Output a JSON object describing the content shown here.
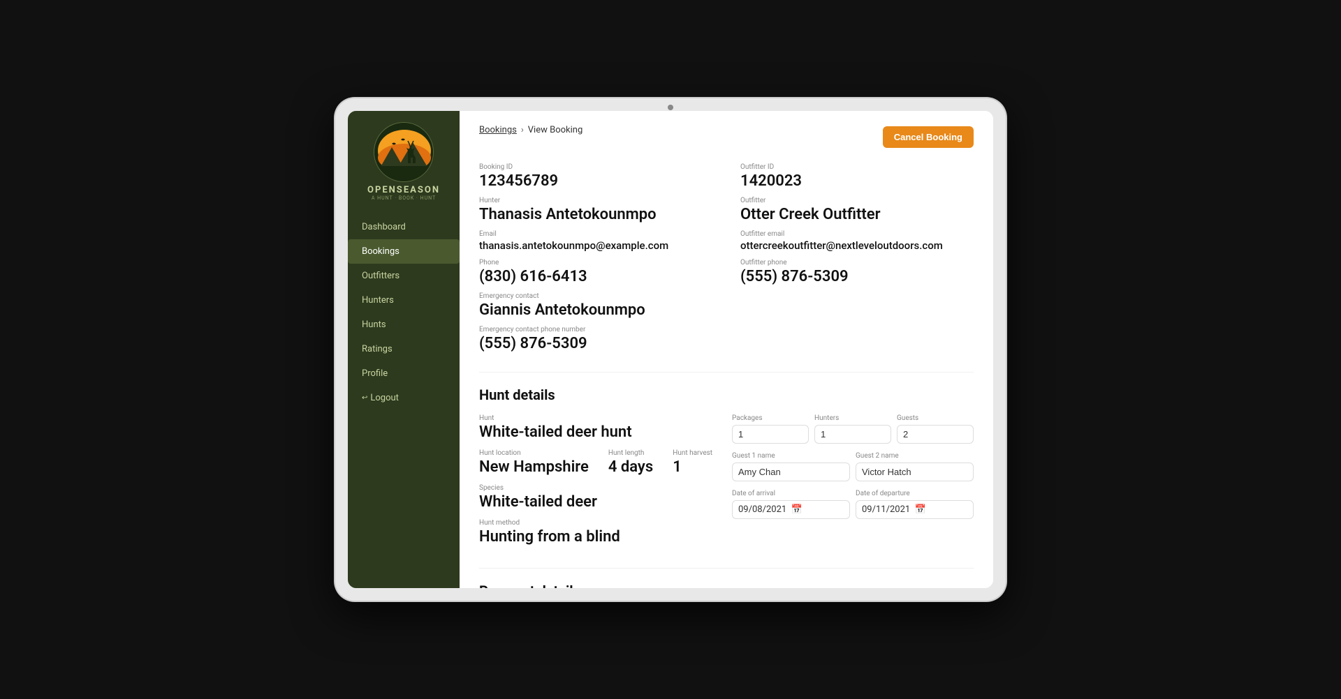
{
  "app": {
    "name": "OPENSEASON",
    "tagline": "A HUNT · BOOK · HUNT"
  },
  "sidebar": {
    "nav_items": [
      {
        "label": "Dashboard",
        "active": false,
        "id": "dashboard"
      },
      {
        "label": "Bookings",
        "active": true,
        "id": "bookings"
      },
      {
        "label": "Outfitters",
        "active": false,
        "id": "outfitters"
      },
      {
        "label": "Hunters",
        "active": false,
        "id": "hunters"
      },
      {
        "label": "Hunts",
        "active": false,
        "id": "hunts"
      },
      {
        "label": "Ratings",
        "active": false,
        "id": "ratings"
      },
      {
        "label": "Profile",
        "active": false,
        "id": "profile"
      },
      {
        "label": "Logout",
        "active": false,
        "id": "logout"
      }
    ]
  },
  "breadcrumb": {
    "parent": "Bookings",
    "separator": "›",
    "current": "View Booking"
  },
  "header": {
    "cancel_button": "Cancel Booking"
  },
  "booking": {
    "booking_id_label": "Booking ID",
    "booking_id": "123456789",
    "outfitter_id_label": "Outfitter ID",
    "outfitter_id": "1420023",
    "hunter_label": "Hunter",
    "hunter_name": "Thanasis Antetokounmpo",
    "outfitter_label": "Outfitter",
    "outfitter_name": "Otter Creek Outfitter",
    "email_label": "Email",
    "email": "thanasis.antetokounmpo@example.com",
    "outfitter_email_label": "Outfitter email",
    "outfitter_email": "ottercreekoutfitter@nextleveloutdoors.com",
    "phone_label": "Phone",
    "phone": "(830) 616-6413",
    "outfitter_phone_label": "Outfitter phone",
    "outfitter_phone": "(555) 876-5309",
    "emergency_contact_label": "Emergency contact",
    "emergency_contact": "Giannis Antetokounmpo",
    "emergency_phone_label": "Emergency contact phone number",
    "emergency_phone": "(555) 876-5309"
  },
  "hunt_details": {
    "section_title": "Hunt details",
    "hunt_label": "Hunt",
    "hunt_name": "White-tailed deer hunt",
    "hunt_location_label": "Hunt location",
    "hunt_location": "New Hampshire",
    "hunt_length_label": "Hunt length",
    "hunt_length": "4 days",
    "hunt_harvest_label": "Hunt harvest",
    "hunt_harvest": "1",
    "species_label": "Species",
    "species": "White-tailed deer",
    "hunt_method_label": "Hunt method",
    "hunt_method": "Hunting from a blind",
    "packages_label": "Packages",
    "packages_value": "1",
    "hunters_label": "Hunters",
    "hunters_value": "1",
    "guests_label": "Guests",
    "guests_value": "2",
    "guest1_label": "Guest 1 name",
    "guest1_value": "Amy Chan",
    "guest2_label": "Guest 2 name",
    "guest2_value": "Victor Hatch",
    "arrival_label": "Date of arrival",
    "arrival_value": "09/08/2021",
    "departure_label": "Date of departure",
    "departure_value": "09/11/2021"
  },
  "payment": {
    "section_title": "Payment details"
  },
  "colors": {
    "accent": "#e8891a",
    "sidebar_bg": "#2d3a1e",
    "sidebar_active": "#4a5a2e"
  }
}
